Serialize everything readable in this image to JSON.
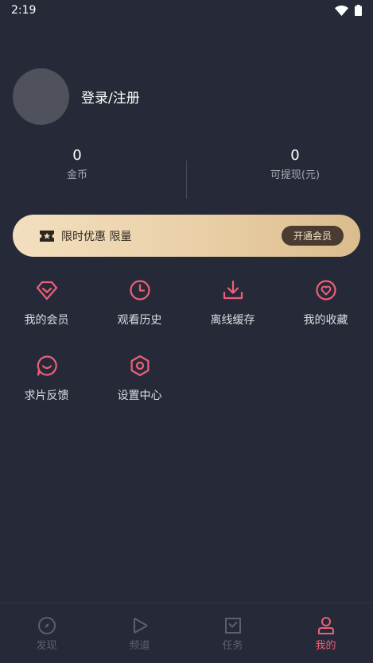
{
  "status_bar": {
    "time": "2:19"
  },
  "profile": {
    "login_label": "登录/注册"
  },
  "stats": [
    {
      "value": "0",
      "label": "金币"
    },
    {
      "value": "0",
      "label": "可提现(元)"
    }
  ],
  "vip_banner": {
    "promo_text": "限时优惠 限量",
    "button_label": "开通会员"
  },
  "menu": [
    {
      "label": "我的会员",
      "icon": "diamond-icon"
    },
    {
      "label": "观看历史",
      "icon": "clock-icon"
    },
    {
      "label": "离线缓存",
      "icon": "download-icon"
    },
    {
      "label": "我的收藏",
      "icon": "heart-icon"
    },
    {
      "label": "求片反馈",
      "icon": "chat-smile-icon"
    },
    {
      "label": "设置中心",
      "icon": "settings-hexagon-icon"
    }
  ],
  "tabs": [
    {
      "label": "发现",
      "icon": "compass-icon",
      "active": false
    },
    {
      "label": "频道",
      "icon": "play-icon",
      "active": false
    },
    {
      "label": "任务",
      "icon": "task-check-icon",
      "active": false
    },
    {
      "label": "我的",
      "icon": "user-icon",
      "active": true
    }
  ],
  "colors": {
    "accent": "#ec5f78",
    "background": "#262a38",
    "vip_gold": "#e9cfa6"
  }
}
